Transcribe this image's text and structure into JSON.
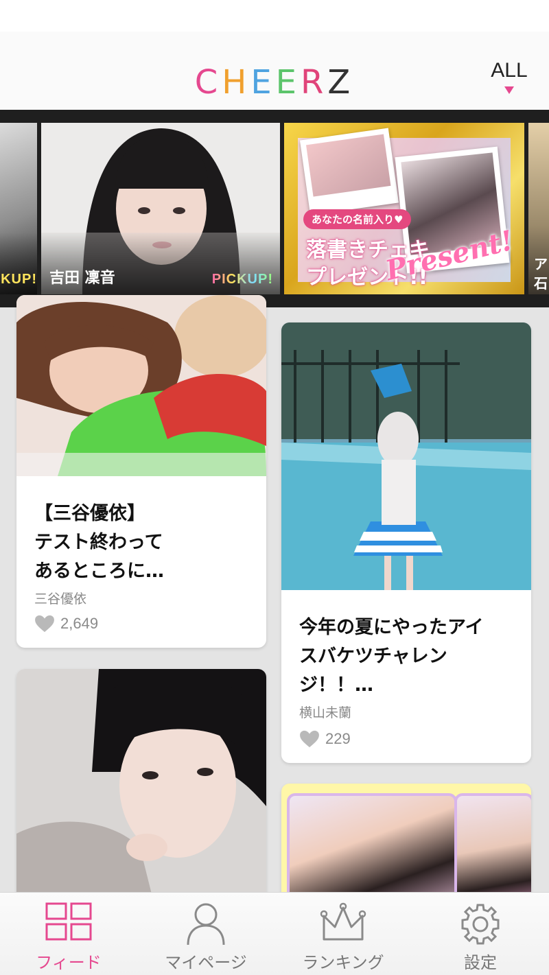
{
  "header": {
    "logo_letters": [
      {
        "char": "C",
        "color": "#e5488f"
      },
      {
        "char": "H",
        "color": "#f0a02e"
      },
      {
        "char": "E",
        "color": "#4fa3e0"
      },
      {
        "char": "E",
        "color": "#5cc46b"
      },
      {
        "char": "R",
        "color": "#e0447a"
      },
      {
        "char": "Z",
        "color": "#333333"
      }
    ],
    "filter_label": "ALL",
    "accent_color": "#e5488f"
  },
  "carousel": {
    "left_partial_badge": "KUP!",
    "main_slide": {
      "name": "吉田 凜音",
      "badge": "PICKUP!"
    },
    "present_banner": {
      "badge": "あなたの名前入り♥",
      "line1": "落書きチェキ",
      "line2": "プレゼント!!",
      "script": "Present!"
    },
    "right_partial": {
      "line1": "ア",
      "line2": "石"
    }
  },
  "feed": {
    "cards": [
      {
        "title_lines": [
          "【三谷優依】",
          "テスト終わって",
          "あるところに…"
        ],
        "author": "三谷優依",
        "likes": "2,649"
      },
      {
        "title_lines": [
          "今年の夏にやったアイ",
          "スバケツチャレン",
          "ジ！！…"
        ],
        "author": "横山未蘭",
        "likes": "229"
      }
    ]
  },
  "tabbar": {
    "tabs": [
      {
        "label": "フィード",
        "icon": "feed-grid-icon",
        "active": true
      },
      {
        "label": "マイページ",
        "icon": "person-icon",
        "active": false
      },
      {
        "label": "ランキング",
        "icon": "crown-icon",
        "active": false
      },
      {
        "label": "設定",
        "icon": "gear-icon",
        "active": false
      }
    ]
  }
}
